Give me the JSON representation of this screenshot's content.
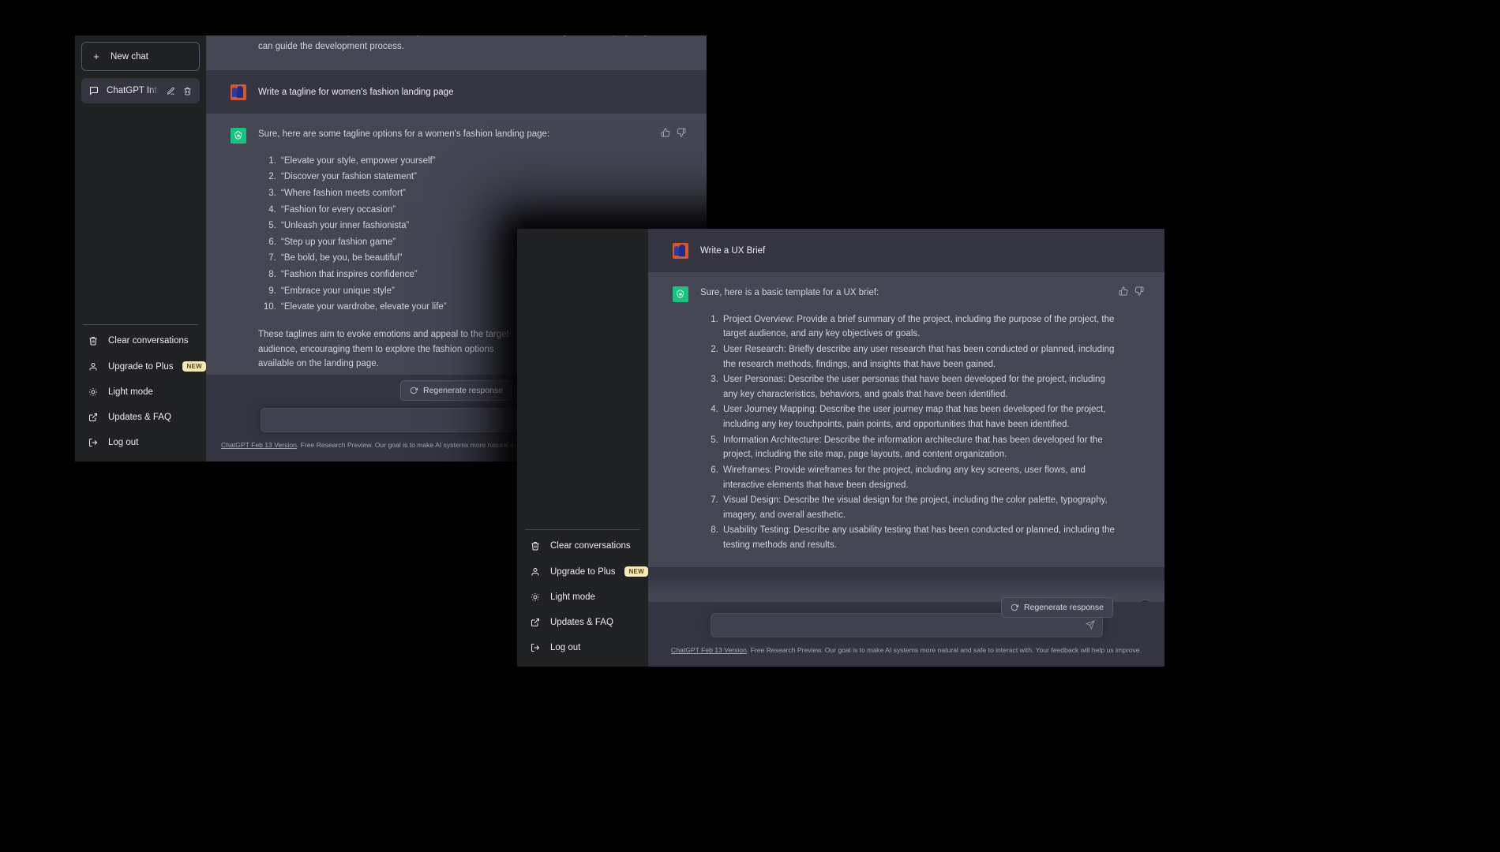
{
  "app": {
    "accent_green": "#19c37d",
    "user_bg": "#343541",
    "bot_bg": "#444654",
    "sidebar_bg": "#202123",
    "badge_bg": "#f5e9ba"
  },
  "sidebar": {
    "new_chat_label": "New chat",
    "conversation": {
      "title": "ChatGPT Introduction.",
      "edit_title": "Edit",
      "delete_title": "Delete"
    },
    "menu": [
      {
        "label": "Clear conversations",
        "icon": "trash-icon",
        "badge": ""
      },
      {
        "label": "Upgrade to Plus",
        "icon": "user-icon",
        "badge": "NEW"
      },
      {
        "label": "Light mode",
        "icon": "sun-icon",
        "badge": ""
      },
      {
        "label": "Updates & FAQ",
        "icon": "external-link-icon",
        "badge": ""
      },
      {
        "label": "Log out",
        "icon": "logout-icon",
        "badge": ""
      }
    ]
  },
  "back_window": {
    "truncated_message": "that have been developed. This can help ensure that all stakeholders are aligned on the project goals and can guide the development process.",
    "user_prompt": "Write a tagline for women's fashion landing page",
    "bot_intro": "Sure, here are some tagline options for a women's fashion landing page:",
    "bot_list": [
      "“Elevate your style, empower yourself”",
      "“Discover your fashion statement”",
      "“Where fashion meets comfort”",
      "“Fashion for every occasion”",
      "“Unleash your inner fashionista”",
      "“Step up your fashion game”",
      "“Be bold, be you, be beautiful”",
      "“Fashion that inspires confidence”",
      "“Embrace your unique style”",
      "“Elevate your wardrobe, elevate your life”"
    ],
    "bot_outro": "These taglines aim to evoke emotions and appeal to the target audience, encouraging them to explore the fashion options available on the landing page.",
    "regenerate_label": "Regenerate response",
    "input_placeholder": "",
    "footer_link": "ChatGPT Feb 13 Version",
    "footer_text": ". Free Research Preview. Our goal is to make AI systems more natural and safe to interact with. Your feedback will help us improve."
  },
  "front_window": {
    "user_prompt": "Write a UX Brief",
    "bot_intro": "Sure, here is a basic template for a UX brief:",
    "bot_list": [
      "Project Overview: Provide a brief summary of the project, including the purpose of the project, the target audience, and any key objectives or goals.",
      "User Research: Briefly describe any user research that has been conducted or planned, including the research methods, findings, and insights that have been gained.",
      "User Personas: Describe the user personas that have been developed for the project, including any key characteristics, behaviors, and goals that have been identified.",
      "User Journey Mapping: Describe the user journey map that has been developed for the project, including any key touchpoints, pain points, and opportunities that have been identified.",
      "Information Architecture: Describe the information architecture that has been developed for the project, including the site map, page layouts, and content organization.",
      "Wireframes: Provide wireframes for the project, including any key screens, user flows, and interactive elements that have been designed.",
      "Visual Design: Describe the visual design for the project, including the color palette, typography, imagery, and overall aesthetic.",
      "Usability Testing: Describe any usability testing that has been conducted or planned, including the testing methods and results."
    ],
    "regenerate_label": "Regenerate response",
    "input_placeholder": "",
    "footer_link": "ChatGPT Feb 13 Version",
    "footer_text": ". Free Research Preview. Our goal is to make AI systems more natural and safe to interact with. Your feedback will help us improve."
  }
}
